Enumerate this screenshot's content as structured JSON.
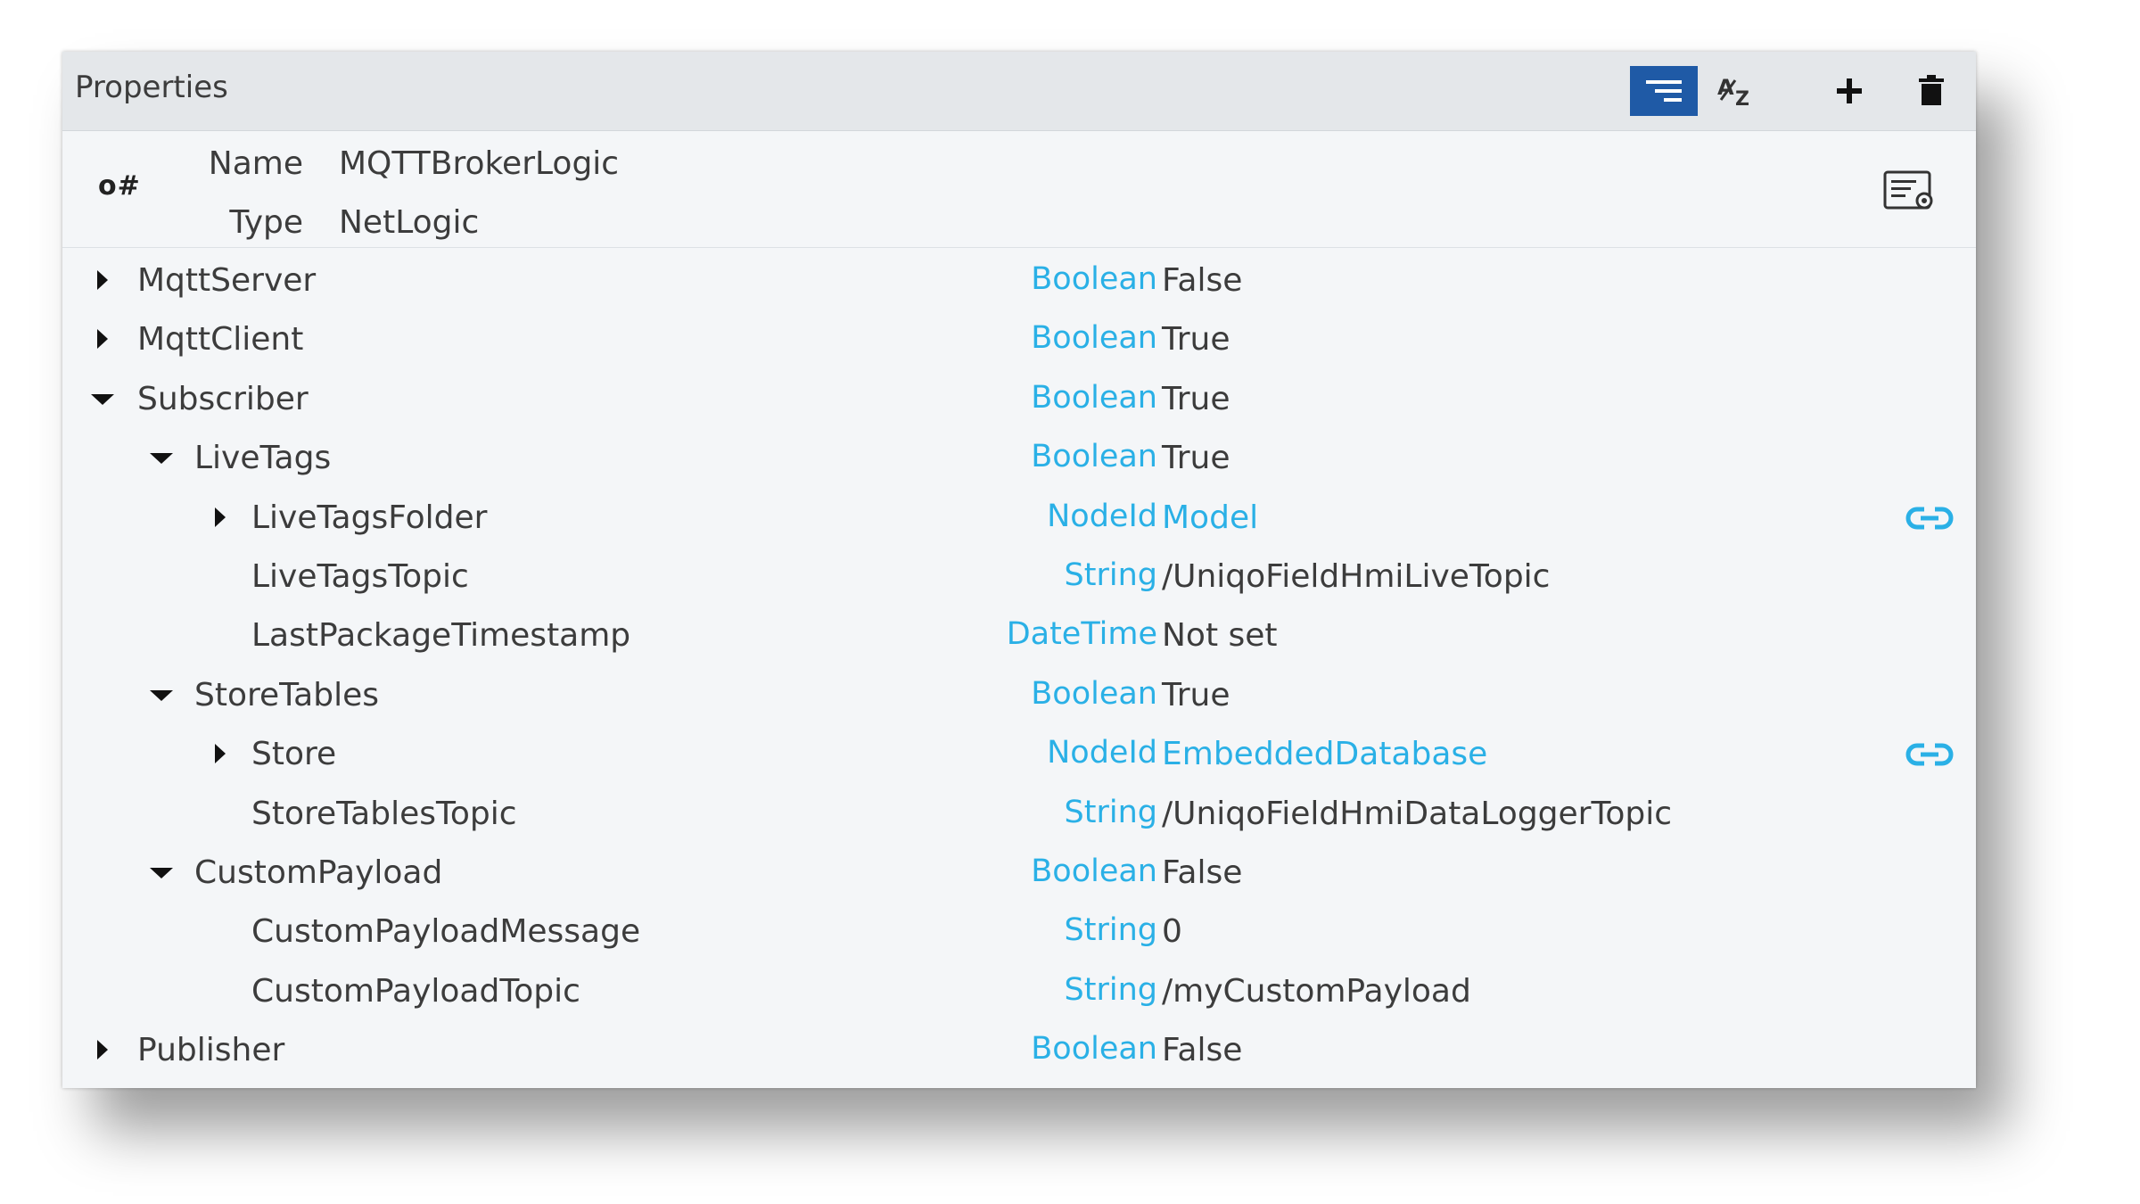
{
  "panel": {
    "title": "Properties",
    "toolbar": {
      "group_icon": "list-filter-icon",
      "sort_icon": "sort-az-icon",
      "add_icon": "plus-icon",
      "delete_icon": "trash-icon"
    }
  },
  "info": {
    "icon_text": "o#",
    "name_label": "Name",
    "name_value": "MQTTBrokerLogic",
    "type_label": "Type",
    "type_value": "NetLogic",
    "action_icon": "settings-panel-icon"
  },
  "colors": {
    "accent": "#1f5aa6",
    "type_text": "#2ab0e6",
    "link_text": "#2ab0e6",
    "text": "#3c3c3c"
  },
  "rows": [
    {
      "name": "MqttServer",
      "type": "Boolean",
      "value": "False",
      "caret": "collapsed",
      "depth": 0,
      "link": false
    },
    {
      "name": "MqttClient",
      "type": "Boolean",
      "value": "True",
      "caret": "collapsed",
      "depth": 0,
      "link": false
    },
    {
      "name": "Subscriber",
      "type": "Boolean",
      "value": "True",
      "caret": "expanded",
      "depth": 0,
      "link": false
    },
    {
      "name": "LiveTags",
      "type": "Boolean",
      "value": "True",
      "caret": "expanded",
      "depth": 1,
      "link": false
    },
    {
      "name": "LiveTagsFolder",
      "type": "NodeId",
      "value": "Model",
      "caret": "collapsed",
      "depth": 2,
      "link": true
    },
    {
      "name": "LiveTagsTopic",
      "type": "String",
      "value": "/UniqoFieldHmiLiveTopic",
      "caret": "none",
      "depth": 2,
      "link": false
    },
    {
      "name": "LastPackageTimestamp",
      "type": "DateTime",
      "value": "Not set",
      "caret": "none",
      "depth": 2,
      "link": false
    },
    {
      "name": "StoreTables",
      "type": "Boolean",
      "value": "True",
      "caret": "expanded",
      "depth": 1,
      "link": false
    },
    {
      "name": "Store",
      "type": "NodeId",
      "value": "EmbeddedDatabase",
      "caret": "collapsed",
      "depth": 2,
      "link": true
    },
    {
      "name": "StoreTablesTopic",
      "type": "String",
      "value": "/UniqoFieldHmiDataLoggerTopic",
      "caret": "none",
      "depth": 2,
      "link": false
    },
    {
      "name": "CustomPayload",
      "type": "Boolean",
      "value": "False",
      "caret": "expanded",
      "depth": 1,
      "link": false
    },
    {
      "name": "CustomPayloadMessage",
      "type": "String",
      "value": "0",
      "caret": "none",
      "depth": 2,
      "link": false
    },
    {
      "name": "CustomPayloadTopic",
      "type": "String",
      "value": "/myCustomPayload",
      "caret": "none",
      "depth": 2,
      "link": false
    },
    {
      "name": "Publisher",
      "type": "Boolean",
      "value": "False",
      "caret": "collapsed",
      "depth": 0,
      "link": false
    }
  ]
}
